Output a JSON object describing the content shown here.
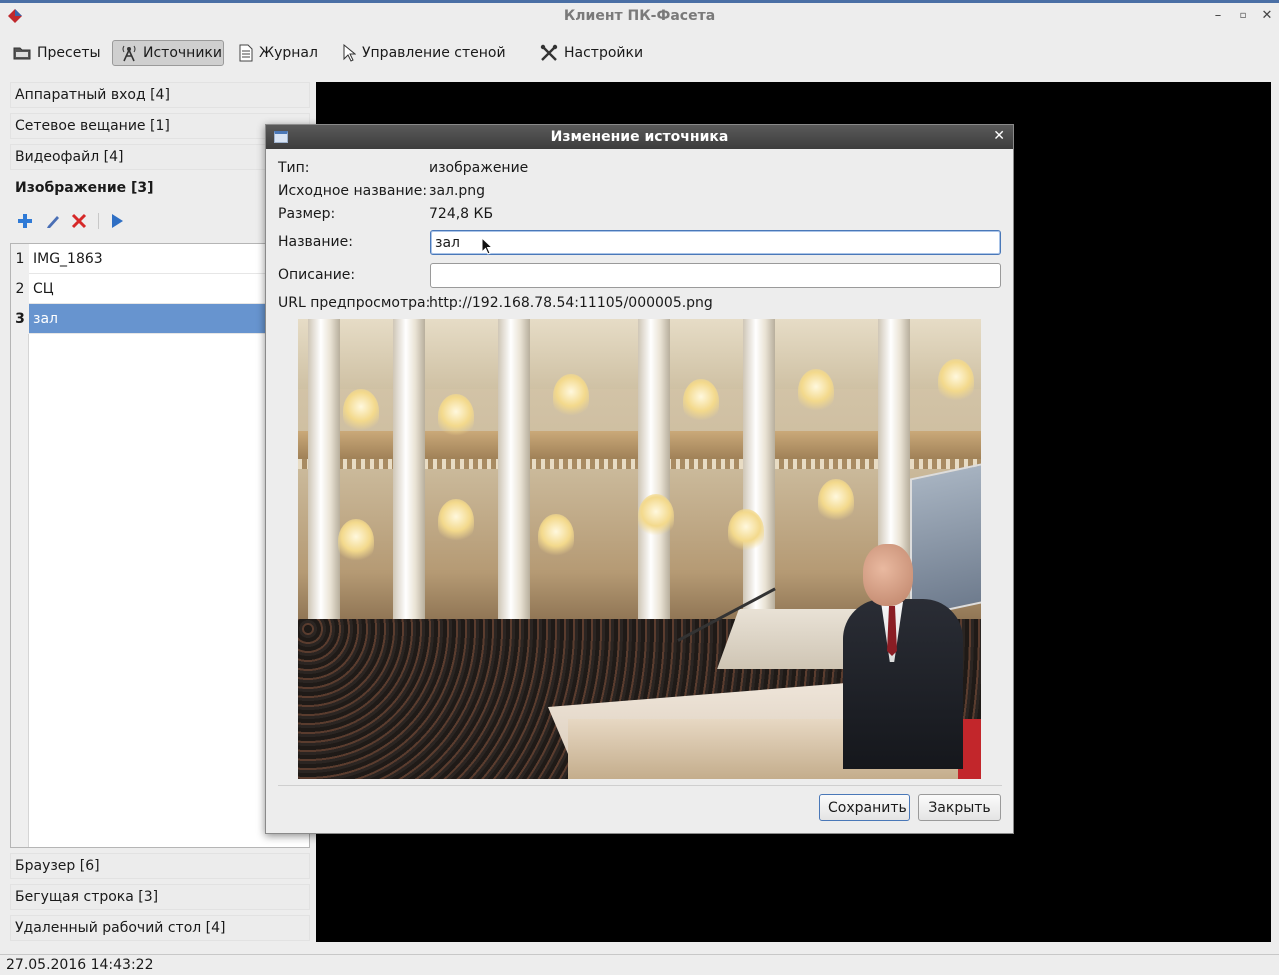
{
  "window": {
    "title": "Клиент ПК-Фасета"
  },
  "toolbar": {
    "presets_label": "Пресеты",
    "sources_label": "Источники",
    "journal_label": "Журнал",
    "wall_label": "Управление стеной",
    "settings_label": "Настройки",
    "active": "sources"
  },
  "sidebar": {
    "categories_top": [
      {
        "label": "Аппаратный вход [4]"
      },
      {
        "label": "Сетевое вещание [1]"
      },
      {
        "label": "Видеофайл [4]"
      }
    ],
    "expanded_category": "Изображение [3]",
    "items": [
      {
        "num": "1",
        "name": "IMG_1863"
      },
      {
        "num": "2",
        "name": "СЦ"
      },
      {
        "num": "3",
        "name": "зал"
      }
    ],
    "selected_index": 2,
    "categories_bottom": [
      {
        "label": "Браузер [6]"
      },
      {
        "label": "Бегущая строка [3]"
      },
      {
        "label": "Удаленный рабочий стол [4]"
      }
    ]
  },
  "dialog": {
    "title": "Изменение источника",
    "type_label": "Тип:",
    "type_value": "изображение",
    "orig_name_label": "Исходное название:",
    "orig_name_value": "зал.png",
    "size_label": "Размер:",
    "size_value": "724,8 КБ",
    "name_label": "Название:",
    "name_value": "зал",
    "desc_label": "Описание:",
    "desc_value": "",
    "url_label": "URL предпросмотра:",
    "url_value": "http://192.168.78.54:11105/000005.png",
    "save_label": "Сохранить",
    "close_label": "Закрыть"
  },
  "statusbar": {
    "datetime": "27.05.2016  14:43:22"
  },
  "colors": {
    "selection": "#6794cf",
    "dialog_title_bg": "#4a4a4a",
    "preview_bg": "#000000"
  }
}
